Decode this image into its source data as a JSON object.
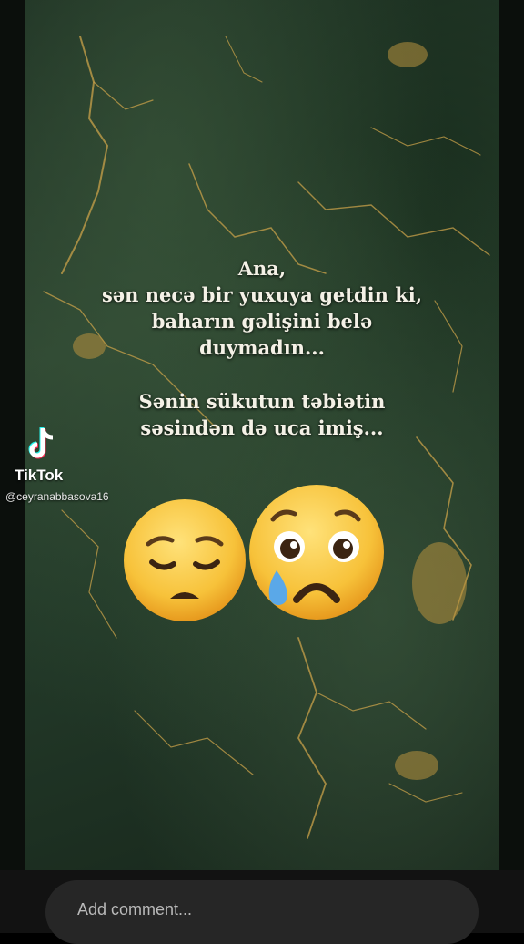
{
  "poem": {
    "line1": "Ana,",
    "line2": "sən necə bir yuxuya getdin ki,",
    "line3": "baharın gəlişini belə",
    "line4": "duymadın...",
    "line5": "Sənin sükutun təbiətin",
    "line6": "səsindən də uca imiş..."
  },
  "watermark": {
    "brand": "TikTok",
    "username": "@ceyranabbasova16"
  },
  "emojis": {
    "left": "pensive-face-icon",
    "right": "crying-face-icon"
  },
  "comment": {
    "placeholder": "Add comment..."
  },
  "colors": {
    "background": "#223a28",
    "vein_gold": "#c9a24a",
    "emoji_yellow": "#f7c23a",
    "text": "#f4f1e6"
  }
}
